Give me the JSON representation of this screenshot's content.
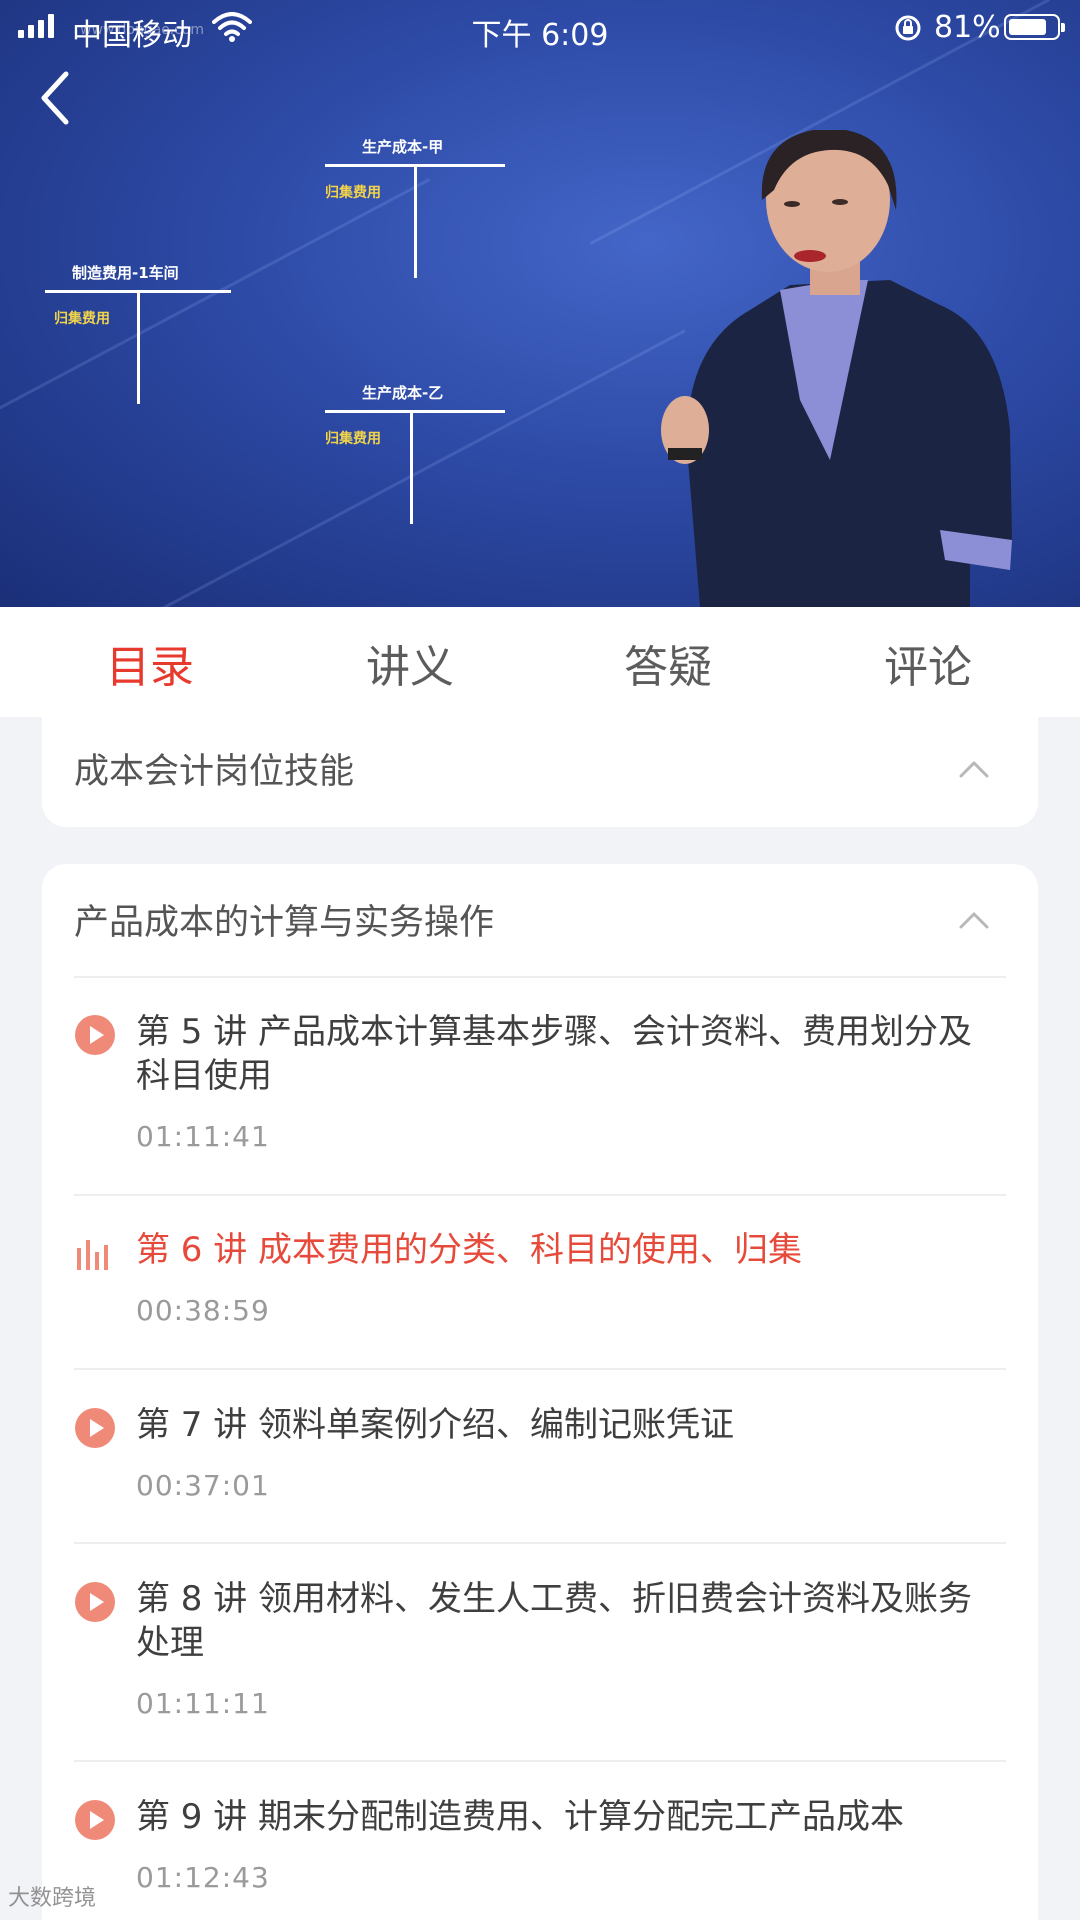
{
  "status_bar": {
    "carrier": "中国移动",
    "time": "下午 6:09",
    "battery": "81%",
    "battery_level": 0.81
  },
  "video": {
    "watermark": "www.dongao.com",
    "accounts": [
      {
        "name": "生产成本-甲",
        "sub": "归集费用"
      },
      {
        "name": "制造费用-1车间",
        "sub": "归集费用"
      },
      {
        "name": "生产成本-乙",
        "sub": "归集费用"
      }
    ]
  },
  "tabs": [
    {
      "label": "目录",
      "active": true
    },
    {
      "label": "讲义",
      "active": false
    },
    {
      "label": "答疑",
      "active": false
    },
    {
      "label": "评论",
      "active": false
    }
  ],
  "sections": [
    {
      "title": "成本会计岗位技能",
      "expanded": true
    },
    {
      "title": "产品成本的计算与实务操作",
      "expanded": true,
      "lessons": [
        {
          "title": "第 5 讲  产品成本计算基本步骤、会计资料、费用划分及科目使用",
          "duration": "01:11:41",
          "state": "idle"
        },
        {
          "title": "第 6 讲  成本费用的分类、科目的使用、归集",
          "duration": "00:38:59",
          "state": "playing"
        },
        {
          "title": "第 7 讲  领料单案例介绍、编制记账凭证",
          "duration": "00:37:01",
          "state": "idle"
        },
        {
          "title": "第 8 讲  领用材料、发生人工费、折旧费会计资料及账务处理",
          "duration": "01:11:11",
          "state": "idle"
        },
        {
          "title": "第 9 讲  期末分配制造费用、计算分配完工产品成本",
          "duration": "01:12:43",
          "state": "idle"
        }
      ]
    }
  ],
  "footer_watermark": "大数跨境",
  "colors": {
    "accent": "#e8392d",
    "play_icon": "#f08a78",
    "background": "#f2f3f7",
    "video_blue": "#2d4aa6"
  }
}
